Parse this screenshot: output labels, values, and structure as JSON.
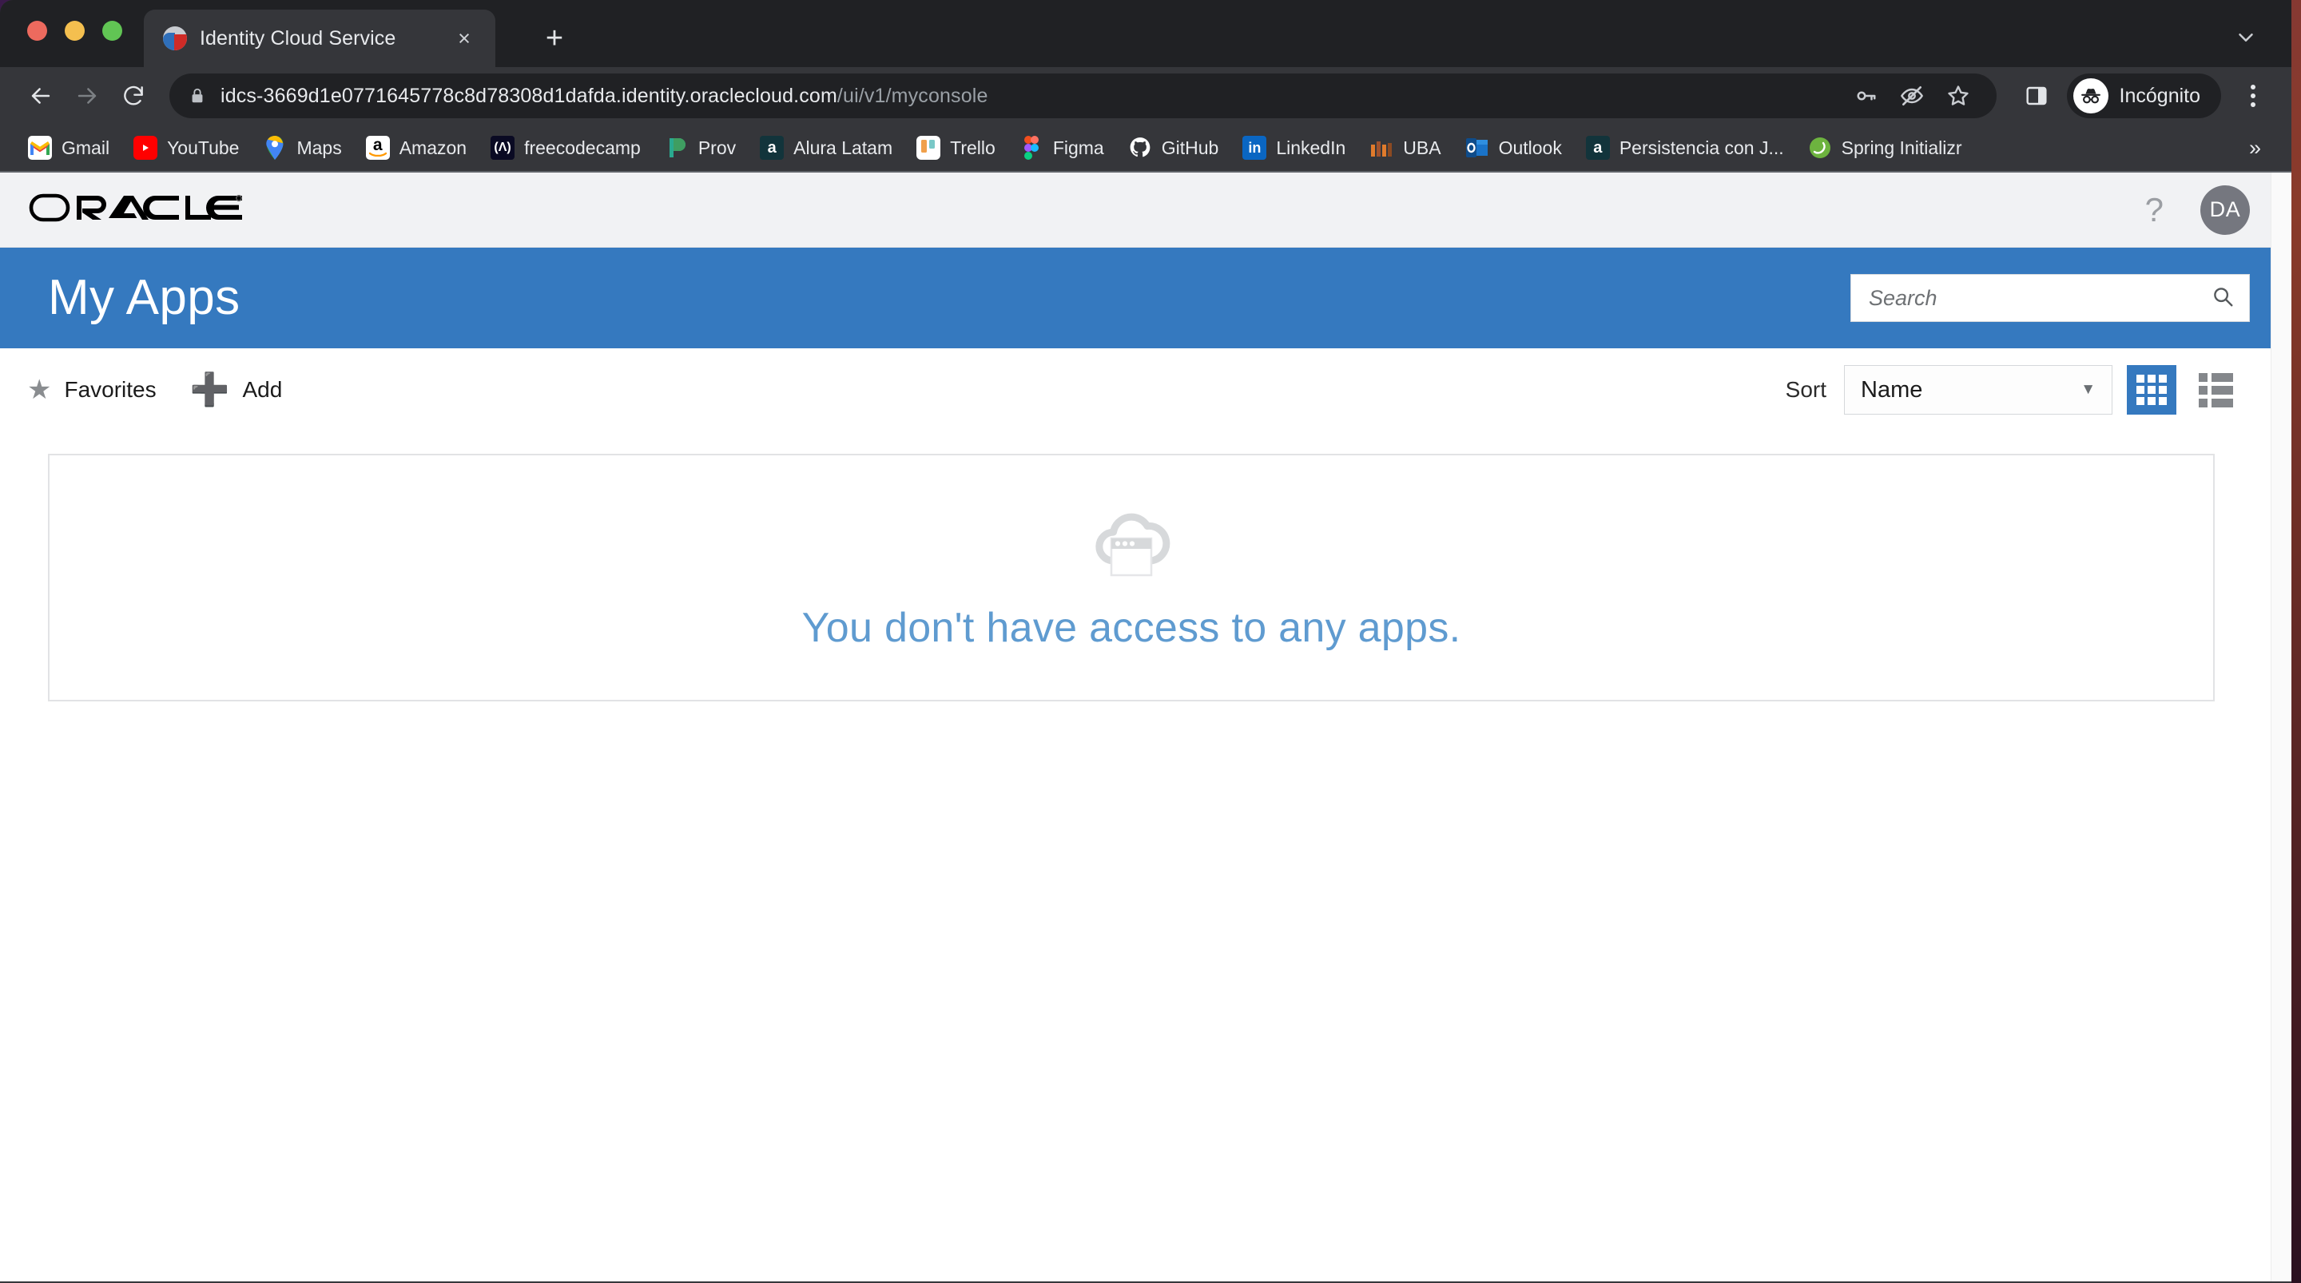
{
  "browser": {
    "window_controls": [
      "close",
      "minimize",
      "maximize"
    ],
    "tab": {
      "title": "Identity Cloud Service",
      "favicon": "oracle-idcs-icon",
      "close_label": "×"
    },
    "new_tab_label": "+",
    "tab_list_label": "⌄",
    "nav": {
      "back": "back-arrow",
      "forward": "forward-arrow",
      "reload": "reload-arrow"
    },
    "omnibox": {
      "security_icon": "lock-icon",
      "url_host": "idcs-3669d1e0771645778c8d78308d1dafda.identity.oraclecloud.com",
      "url_path": "/ui/v1/myconsole",
      "actions": [
        "key-icon",
        "eye-slash-icon",
        "star-icon"
      ]
    },
    "side_panel_label": "side-panel-icon",
    "profile": {
      "label": "Incógnito",
      "icon": "incognito-icon"
    },
    "menu_label": "kebab-menu-icon",
    "bookmarks": [
      {
        "label": "Gmail",
        "icon": "gmail-icon"
      },
      {
        "label": "YouTube",
        "icon": "youtube-icon"
      },
      {
        "label": "Maps",
        "icon": "google-maps-icon"
      },
      {
        "label": "Amazon",
        "icon": "amazon-icon"
      },
      {
        "label": "freecodecamp",
        "icon": "freecodecamp-icon"
      },
      {
        "label": "Prov",
        "icon": "prov-icon"
      },
      {
        "label": "Alura Latam",
        "icon": "alura-icon"
      },
      {
        "label": "Trello",
        "icon": "trello-icon"
      },
      {
        "label": "Figma",
        "icon": "figma-icon"
      },
      {
        "label": "GitHub",
        "icon": "github-icon"
      },
      {
        "label": "LinkedIn",
        "icon": "linkedin-icon"
      },
      {
        "label": "UBA",
        "icon": "uba-icon"
      },
      {
        "label": "Outlook",
        "icon": "outlook-icon"
      },
      {
        "label": "Persistencia con J...",
        "icon": "alura-icon"
      },
      {
        "label": "Spring Initializr",
        "icon": "spring-icon"
      }
    ],
    "bookmarks_overflow": "»"
  },
  "app": {
    "brand": "ORACLE",
    "brand_trademark": "®",
    "help_label": "?",
    "avatar_initials": "DA",
    "banner": {
      "title": "My Apps",
      "search_placeholder": "Search",
      "search_value": "",
      "search_icon": "search-icon",
      "accent_color": "#3579bf"
    },
    "toolbar": {
      "favorites_label": "Favorites",
      "favorites_icon": "star-icon",
      "add_label": "Add",
      "add_icon": "plus-icon",
      "sort_label": "Sort",
      "sort_value": "Name",
      "sort_options": [
        "Name"
      ],
      "view_grid_label": "grid-view-icon",
      "view_list_label": "list-view-icon",
      "active_view": "grid"
    },
    "empty_state": {
      "icon": "cloud-app-icon",
      "message": "You don't have access to any apps.",
      "message_color": "#5f9bd0"
    }
  }
}
